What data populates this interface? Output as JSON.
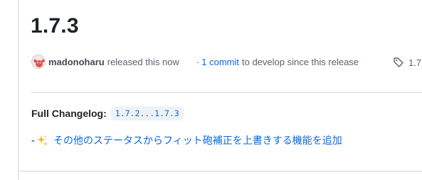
{
  "release": {
    "title": "1.7.3"
  },
  "meta": {
    "author": "madonoharu",
    "released_text": "released this now",
    "separator": "·",
    "commit_link": "1 commit",
    "since_text": "to develop since this release",
    "tag_label": "1.7",
    "avatar_icon": "crab-avatar-icon",
    "tag_icon": "tag-icon"
  },
  "body": {
    "changelog_label": "Full Changelog:",
    "changelog_link": "1.7.2...1.7.3",
    "entry_dash": "-",
    "entry_icon": "sparkles-icon",
    "entry_text": "その他のステータスからフィット砲補正を上書きする機能を追加"
  },
  "colors": {
    "link": "#0969da",
    "muted": "#59636e",
    "border": "#d0d7de",
    "code_bg": "#eff2f5"
  }
}
